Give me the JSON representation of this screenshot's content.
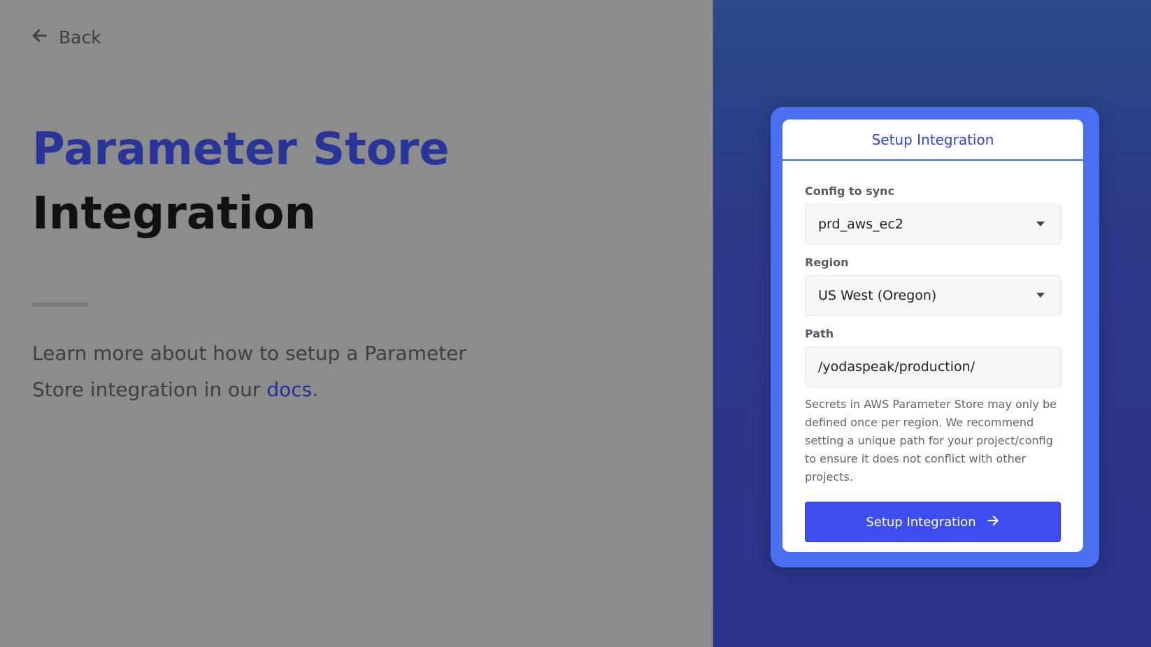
{
  "back": {
    "label": "Back",
    "icon": "arrow-left-icon"
  },
  "hero": {
    "title_line1": "Parameter Store",
    "title_line2": "Integration",
    "learn_prefix": "Learn more about how to setup a Parameter Store integration in our ",
    "learn_link": "docs",
    "learn_suffix": "."
  },
  "card": {
    "header": "Setup Integration",
    "config": {
      "label": "Config to sync",
      "value": "prd_aws_ec2"
    },
    "region": {
      "label": "Region",
      "value": "US West (Oregon)"
    },
    "path": {
      "label": "Path",
      "value": "/yodaspeak/production/"
    },
    "help": "Secrets in AWS Parameter Store may only be defined once per region. We recommend setting a unique path for your project/config to ensure it does not conflict with other projects.",
    "submit_label": "Setup Integration",
    "submit_icon": "arrow-right-icon"
  },
  "colors": {
    "title_accent": "#2a3599",
    "button": "#3d4df0",
    "card_frame": "#4a6ff0",
    "right_bg": "#2c348a",
    "left_bg": "#8c8c8c"
  }
}
